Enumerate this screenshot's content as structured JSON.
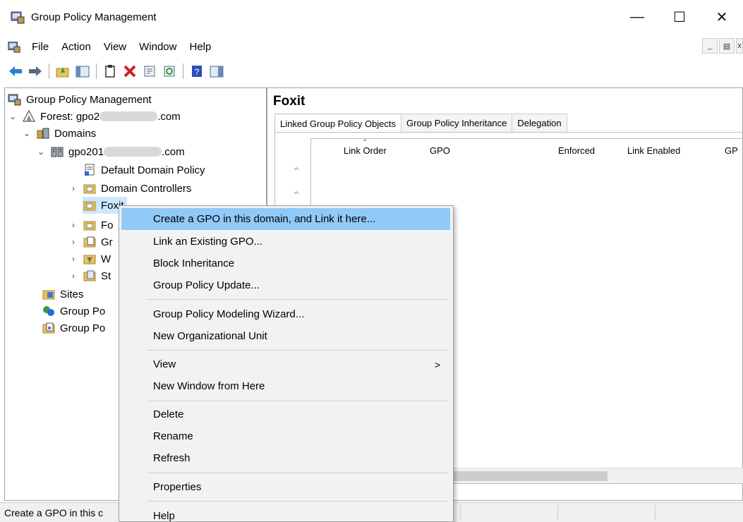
{
  "window": {
    "title": "Group Policy Management",
    "minimize_icon": "minimize-icon",
    "maximize_icon": "maximize-icon",
    "close_icon": "close-icon"
  },
  "menu": [
    "File",
    "Action",
    "View",
    "Window",
    "Help"
  ],
  "toolbar": [
    "back-arrow-icon",
    "forward-arrow-icon",
    "up-folder-icon",
    "show-hide-tree-icon",
    "clipboard-icon",
    "delete-icon",
    "properties-icon",
    "refresh-icon",
    "help-icon",
    "console-tree-icon"
  ],
  "tree": {
    "root": "Group Policy Management",
    "forest_prefix": "Forest: gpo2",
    "forest_suffix": ".com",
    "domains": "Domains",
    "domain_prefix": "gpo201",
    "domain_suffix": ".com",
    "default_domain_policy": "Default Domain Policy",
    "domain_controllers": "Domain Controllers",
    "foxit": "Fo",
    "foxit_tail": "xit",
    "fo": "Fo",
    "gr": "Gr",
    "w": "W",
    "st": "St",
    "sites": "Sites",
    "group_po_1": "Group Po",
    "group_po_2": "Group Po"
  },
  "right_pane": {
    "title": "Foxit",
    "tabs": [
      "Linked Group Policy Objects",
      "Group Policy Inheritance",
      "Delegation"
    ],
    "columns": [
      "Link Order",
      "GPO",
      "Enforced",
      "Link Enabled",
      "GP"
    ]
  },
  "context_menu": {
    "items": [
      "Create a GPO in this domain, and Link it here...",
      "Link an Existing GPO...",
      "Block Inheritance",
      "Group Policy Update...",
      "Group Policy Modeling Wizard...",
      "New Organizational Unit",
      "View",
      "New Window from Here",
      "Delete",
      "Rename",
      "Refresh",
      "Properties",
      "Help"
    ],
    "submenu_arrow": ">"
  },
  "status": {
    "text": "Create a GPO in this c"
  },
  "colors": {
    "highlight": "#91c9f7",
    "selection": "#cce8ff",
    "menu_bg": "#f2f2f2"
  }
}
